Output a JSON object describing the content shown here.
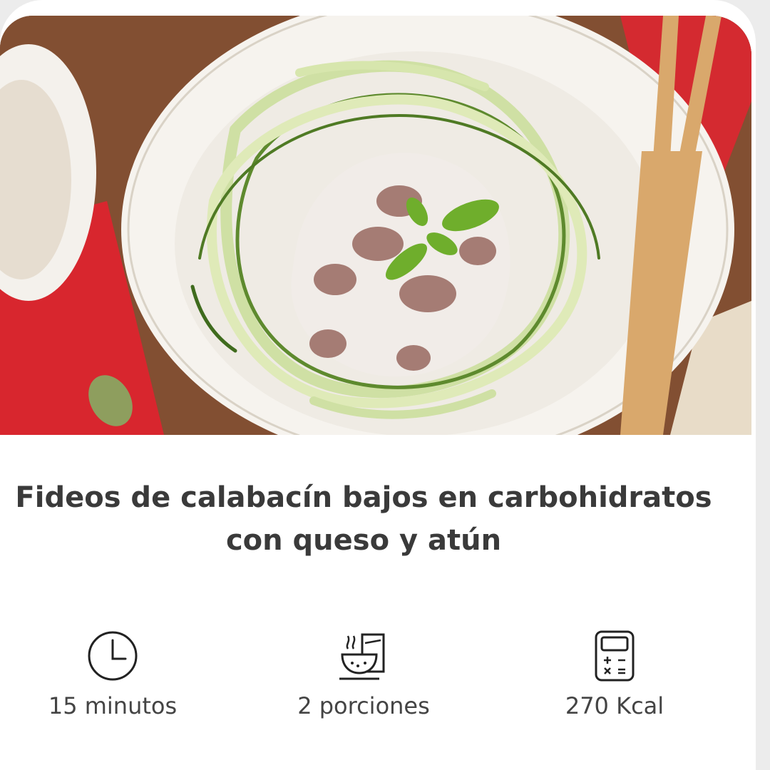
{
  "recipe": {
    "title_line1": "Fideos de calabacín bajos en carbohidratos",
    "title_line2": "con queso y atún",
    "image_alt": "Fideos de calabacín con salsa de queso, atún y albahaca en un plato blanco"
  },
  "stats": [
    {
      "icon": "clock-icon",
      "label": "15 minutos"
    },
    {
      "icon": "bowl-servings-icon",
      "label": "2 porciones"
    },
    {
      "icon": "calculator-icon",
      "label": "270 Kcal"
    }
  ],
  "colors": {
    "title_text": "#3a3a3a",
    "label_text": "#444444",
    "napkin_red": "#d8262e",
    "wood": "#7b4a2e",
    "zucchini_green": "#6a8f3a"
  }
}
